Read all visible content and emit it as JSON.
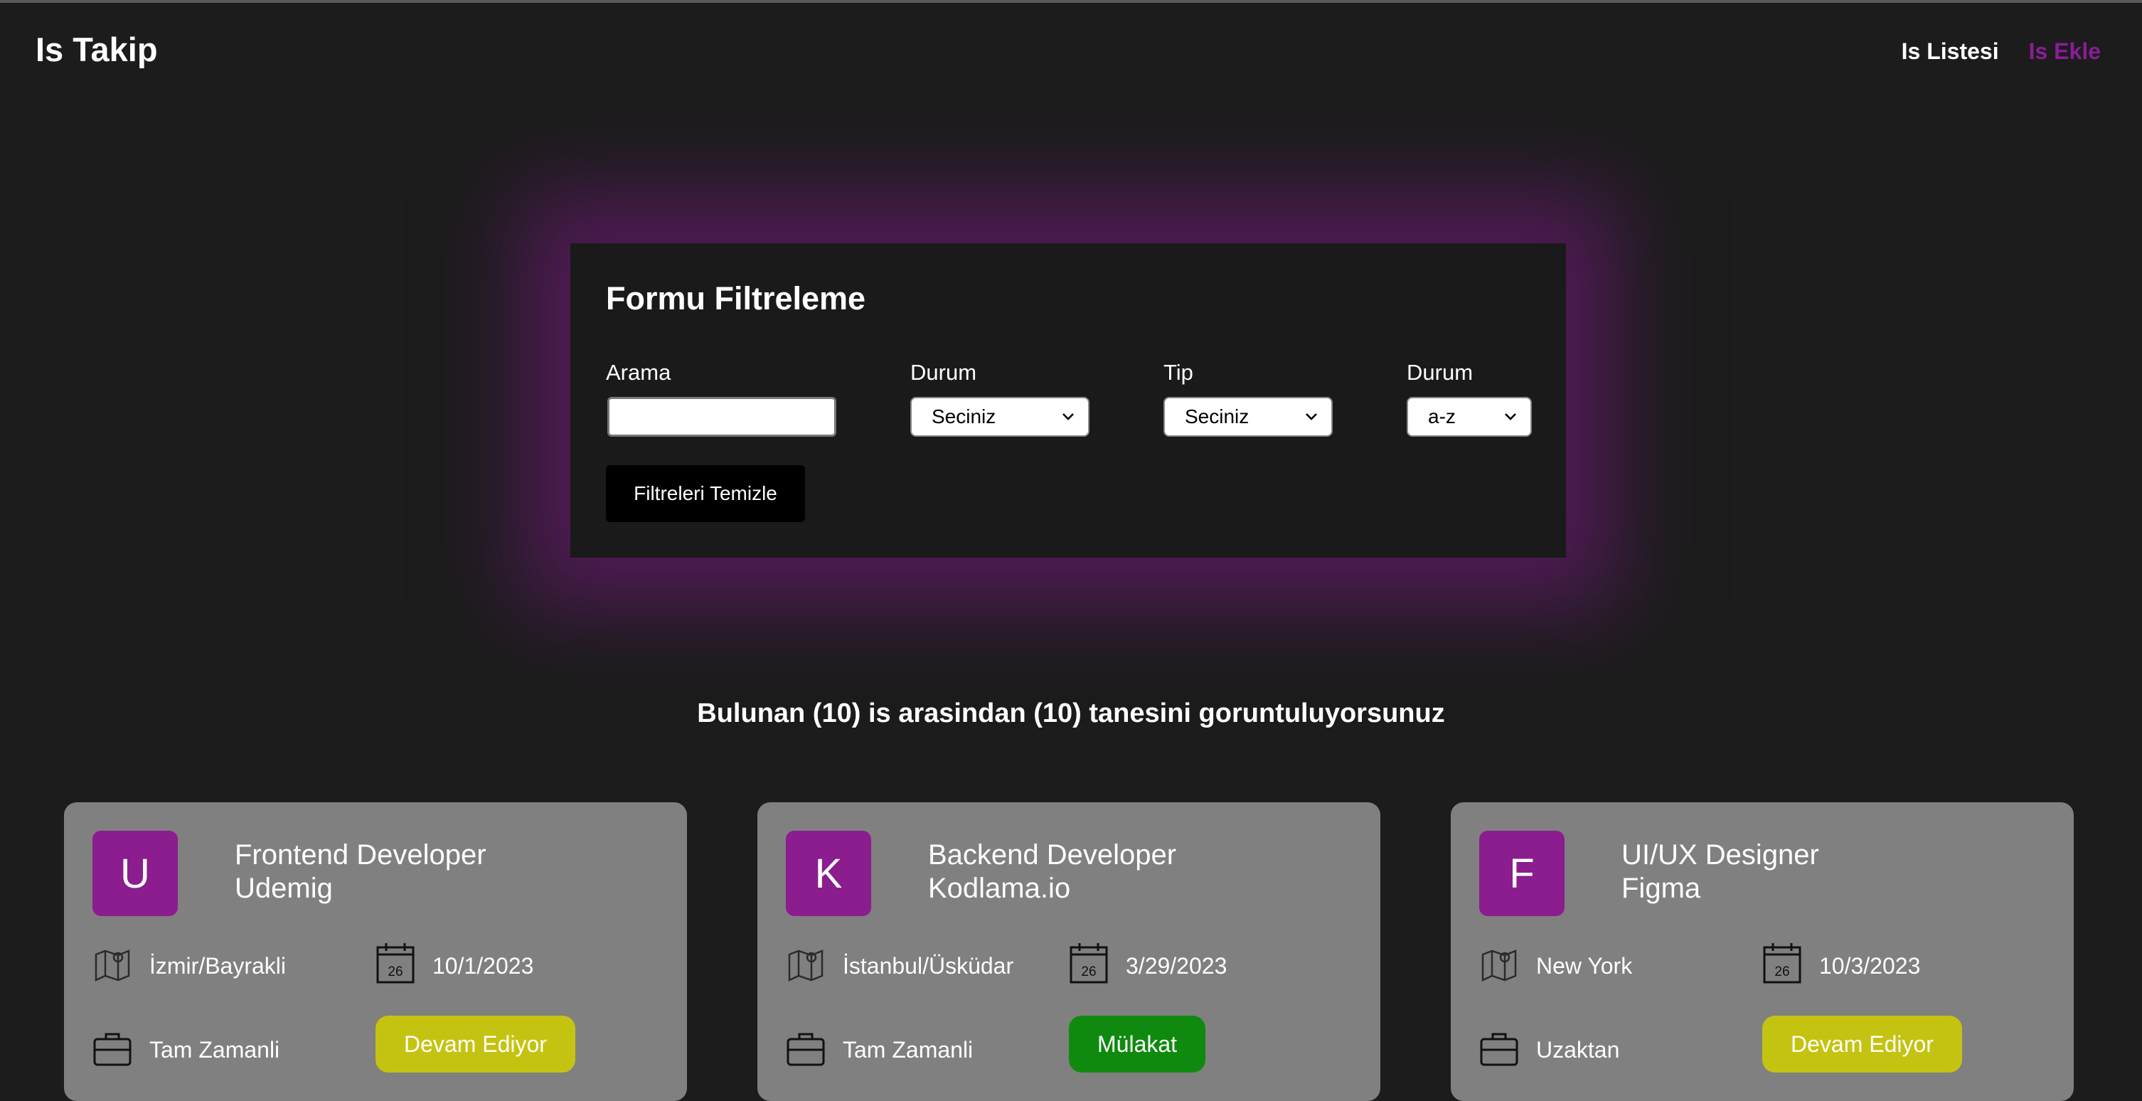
{
  "nav": {
    "brand": "Is Takip",
    "links": [
      {
        "label": "Is Listesi"
      },
      {
        "label": "Is Ekle"
      }
    ]
  },
  "filter": {
    "title": "Formu Filtreleme",
    "search_label": "Arama",
    "search_value": "",
    "status_label": "Durum",
    "status_value": "Seciniz",
    "type_label": "Tip",
    "type_value": "Seciniz",
    "sort_label": "Durum",
    "sort_value": "a-z",
    "clear_button": "Filtreleri Temizle"
  },
  "summary": "Bulunan (10) is arasindan (10) tanesini goruntuluyorsunuz",
  "jobs": [
    {
      "initial": "U",
      "position": "Frontend Developer",
      "company": "Udemig",
      "location": "İzmir/Bayrakli",
      "date": "10/1/2023",
      "calendar_day": "26",
      "type": "Tam Zamanli",
      "status": "Devam Ediyor"
    },
    {
      "initial": "K",
      "position": "Backend Developer",
      "company": "Kodlama.io",
      "location": "İstanbul/Üsküdar",
      "date": "3/29/2023",
      "calendar_day": "26",
      "type": "Tam Zamanli",
      "status": "Mülakat"
    },
    {
      "initial": "F",
      "position": "UI/UX Designer",
      "company": "Figma",
      "location": "New York",
      "date": "10/3/2023",
      "calendar_day": "26",
      "type": "Uzaktan",
      "status": "Devam Ediyor"
    }
  ],
  "colors": {
    "background": "#1c1c1c",
    "accent": "#8b1d96",
    "card": "#808080",
    "status_devam": "#c5c312",
    "status_mulakat": "#0f8a0f"
  },
  "icons": {
    "location": "map-icon",
    "date": "calendar-icon",
    "type": "briefcase-icon",
    "select": "chevron-down-icon"
  }
}
